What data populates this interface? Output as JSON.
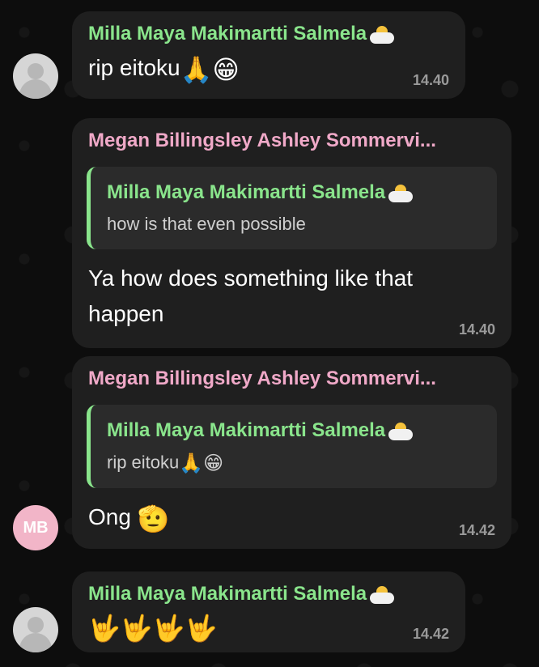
{
  "messages": [
    {
      "sender": "Milla Maya Makimartti Salmela",
      "text": "rip eitoku",
      "emoji": "🙏😁",
      "time": "14.40"
    },
    {
      "sender": "Megan Billingsley Ashley Sommervi...",
      "quote": {
        "sender": "Milla Maya Makimartti Salmela",
        "text": "how is that even possible"
      },
      "text_line1": "Ya how does something like that",
      "text_line2": "happen",
      "time": "14.40"
    },
    {
      "sender": "Megan Billingsley Ashley Sommervi...",
      "quote": {
        "sender": "Milla Maya Makimartti Salmela",
        "text": "rip eitoku",
        "emoji": "🙏😁"
      },
      "text": "Ong",
      "emoji": "🫡",
      "time": "14.42",
      "avatar_initials": "MB"
    },
    {
      "sender": "Milla Maya Makimartti Salmela",
      "emoji": "🤟🤟🤟🤟",
      "time": "14.42"
    }
  ],
  "colors": {
    "green_name": "#8ae58c",
    "pink_name": "#f0a9c8",
    "bubble": "#1f1f1f",
    "background": "#0d0d0d"
  }
}
